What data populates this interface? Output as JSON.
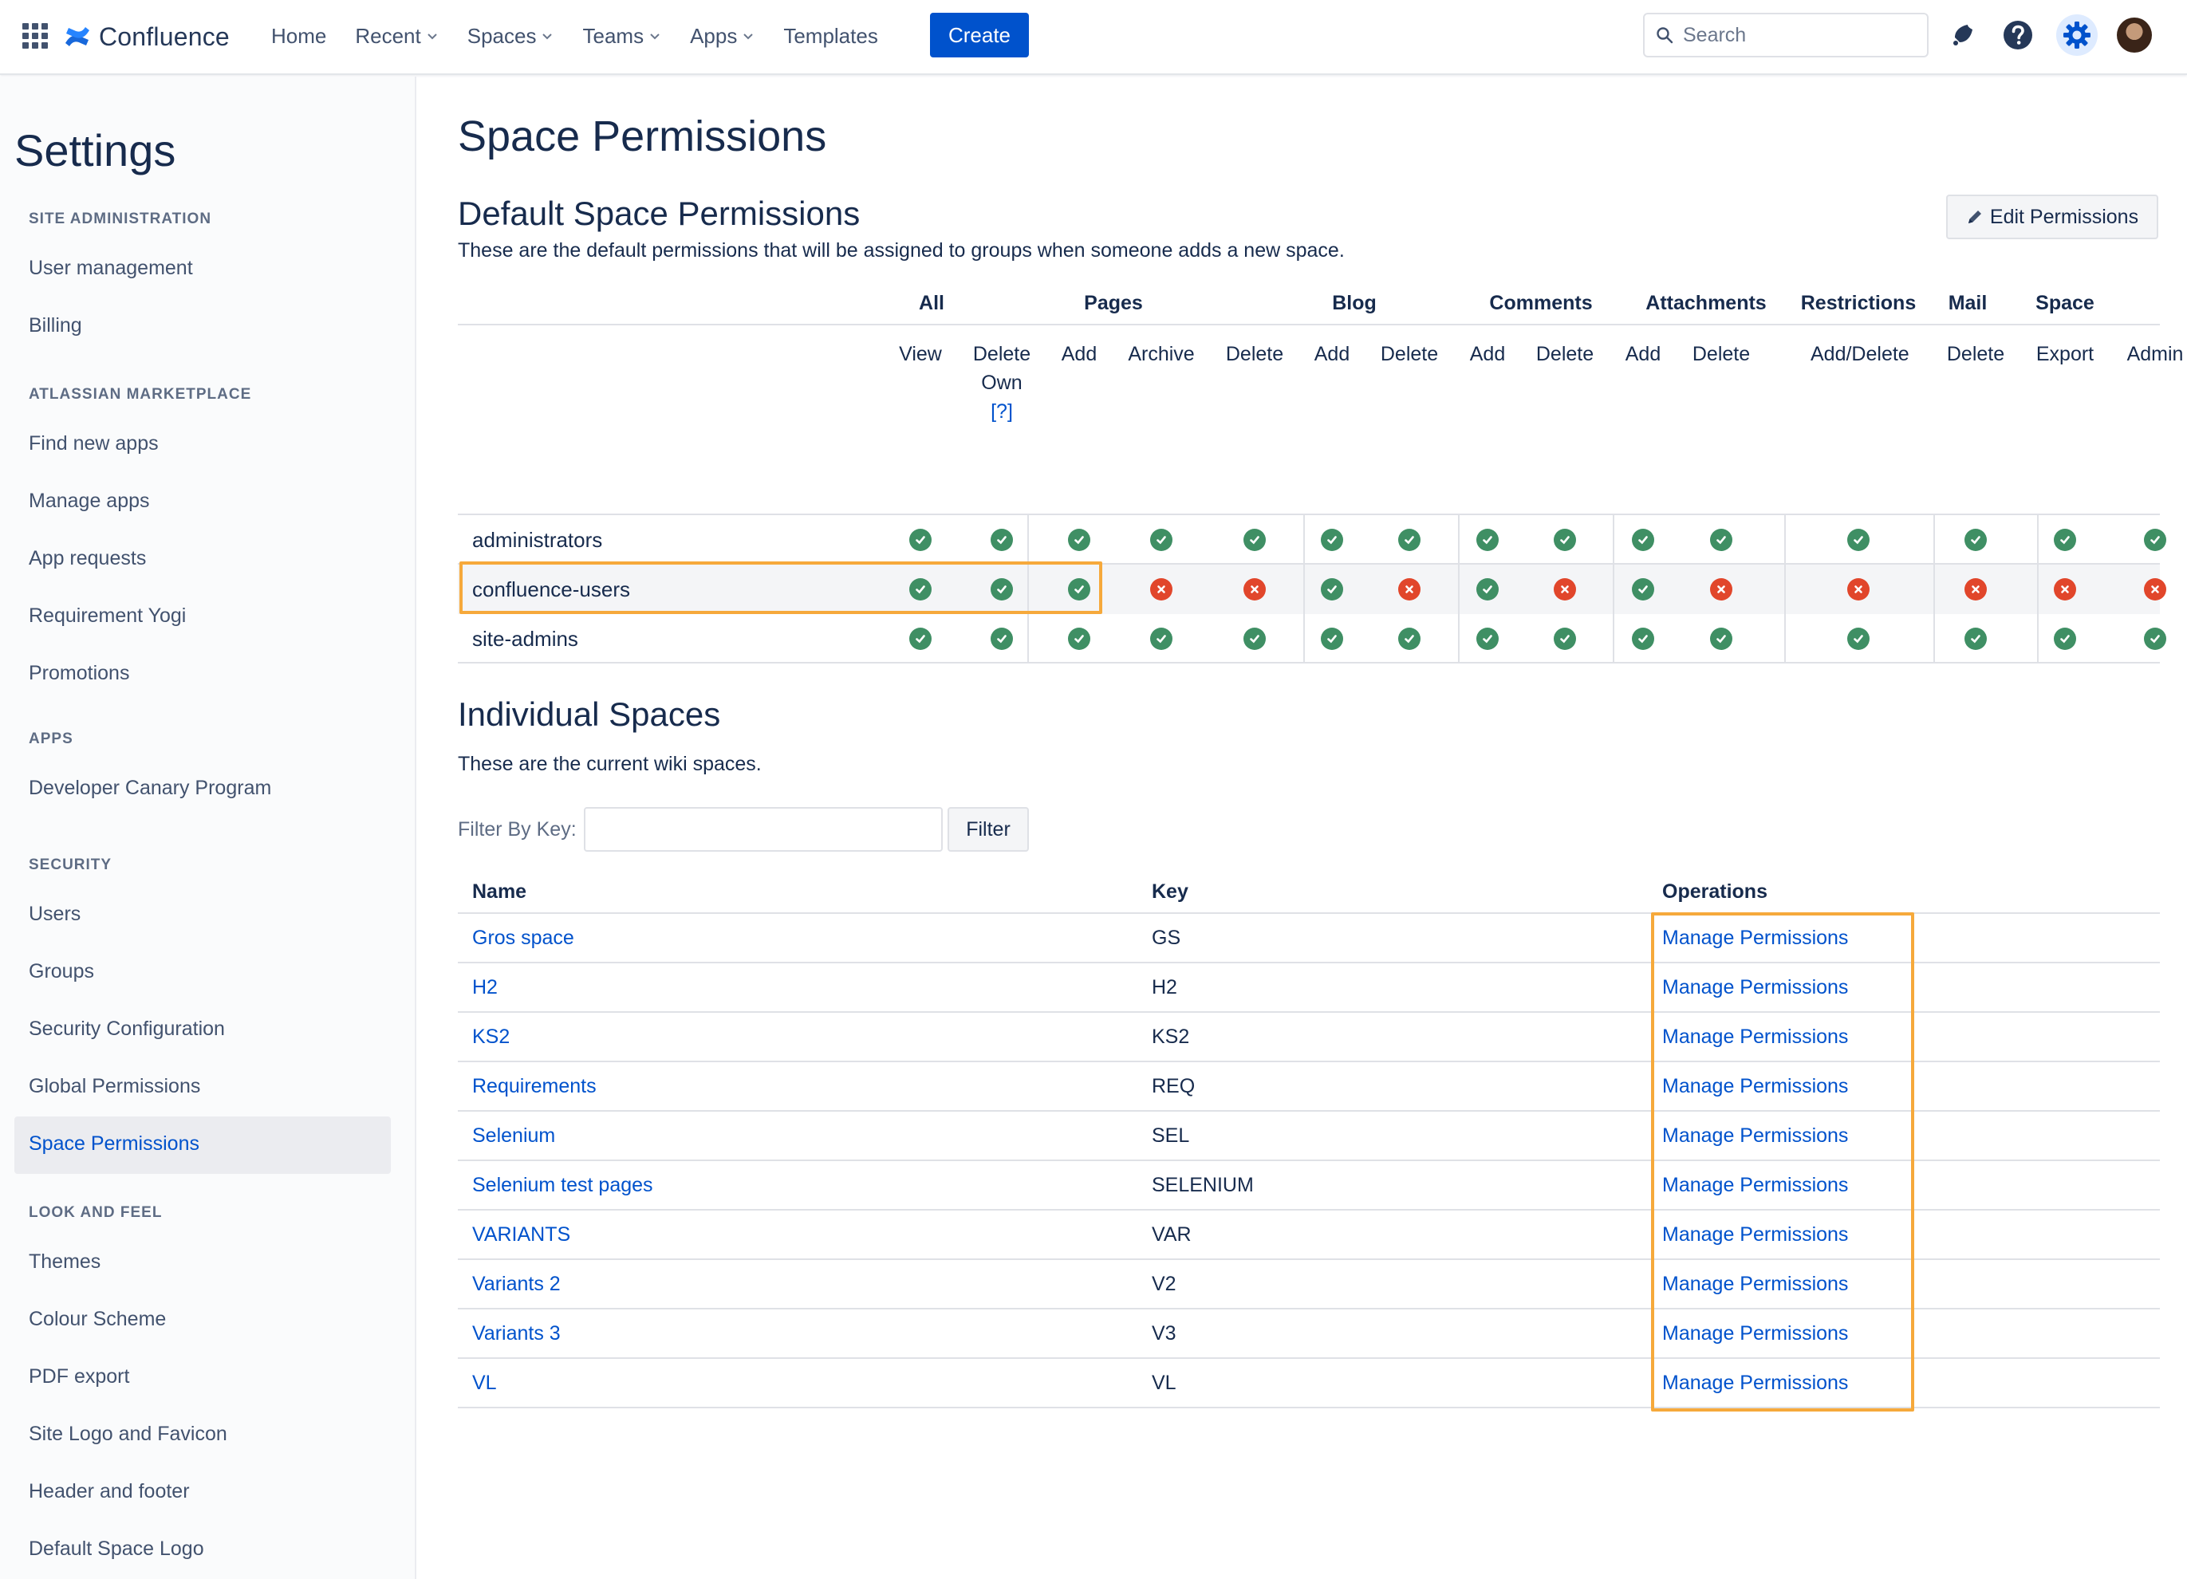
{
  "topnav": {
    "app_name": "Confluence",
    "items": [
      {
        "label": "Home",
        "dropdown": false
      },
      {
        "label": "Recent",
        "dropdown": true
      },
      {
        "label": "Spaces",
        "dropdown": true
      },
      {
        "label": "Teams",
        "dropdown": true
      },
      {
        "label": "Apps",
        "dropdown": true
      },
      {
        "label": "Templates",
        "dropdown": false
      }
    ],
    "create_label": "Create",
    "search_placeholder": "Search",
    "accent": "#0052cc"
  },
  "sidebar": {
    "title": "Settings",
    "sections": [
      {
        "heading": "SITE ADMINISTRATION",
        "items": [
          "User management",
          "Billing"
        ]
      },
      {
        "heading": "ATLASSIAN MARKETPLACE",
        "items": [
          "Find new apps",
          "Manage apps",
          "App requests",
          "Requirement Yogi",
          "Promotions"
        ]
      },
      {
        "heading": "APPS",
        "items": [
          "Developer Canary Program"
        ]
      },
      {
        "heading": "SECURITY",
        "items": [
          "Users",
          "Groups",
          "Security Configuration",
          "Global Permissions",
          "Space Permissions"
        ]
      },
      {
        "heading": "LOOK AND FEEL",
        "items": [
          "Themes",
          "Colour Scheme",
          "PDF export",
          "Site Logo and Favicon",
          "Header and footer",
          "Default Space Logo"
        ]
      }
    ],
    "active_item": "Space Permissions"
  },
  "main": {
    "title": "Space Permissions",
    "default_heading": "Default Space Permissions",
    "default_desc": "These are the default permissions that will be assigned to groups when someone adds a new space.",
    "edit_label": "Edit Permissions",
    "perm_groups": [
      "All",
      "Pages",
      "Blog",
      "Comments",
      "Attachments",
      "Restrictions",
      "Mail",
      "Space"
    ],
    "perm_columns": [
      "View",
      "Delete Own",
      "Add",
      "Archive",
      "Delete",
      "Add",
      "Delete",
      "Add",
      "Delete",
      "Add",
      "Delete",
      "Add/Delete",
      "Delete",
      "Export",
      "Admin"
    ],
    "help_link": "[?]",
    "perm_rows": [
      {
        "group": "administrators",
        "values": [
          1,
          1,
          1,
          1,
          1,
          1,
          1,
          1,
          1,
          1,
          1,
          1,
          1,
          1,
          1
        ]
      },
      {
        "group": "confluence-users",
        "values": [
          1,
          1,
          1,
          0,
          0,
          1,
          0,
          1,
          0,
          1,
          0,
          0,
          0,
          0,
          0
        ]
      },
      {
        "group": "site-admins",
        "values": [
          1,
          1,
          1,
          1,
          1,
          1,
          1,
          1,
          1,
          1,
          1,
          1,
          1,
          1,
          1
        ]
      }
    ],
    "individual_heading": "Individual Spaces",
    "individual_desc": "These are the current wiki spaces.",
    "filter_label": "Filter By Key:",
    "filter_value": "",
    "filter_button": "Filter",
    "spaces_headers": {
      "name": "Name",
      "key": "Key",
      "operations": "Operations"
    },
    "spaces": [
      {
        "name": "Gros space",
        "key": "GS",
        "op": "Manage Permissions"
      },
      {
        "name": "H2",
        "key": "H2",
        "op": "Manage Permissions"
      },
      {
        "name": "KS2",
        "key": "KS2",
        "op": "Manage Permissions"
      },
      {
        "name": "Requirements",
        "key": "REQ",
        "op": "Manage Permissions"
      },
      {
        "name": "Selenium",
        "key": "SEL",
        "op": "Manage Permissions"
      },
      {
        "name": "Selenium test pages",
        "key": "SELENIUM",
        "op": "Manage Permissions"
      },
      {
        "name": "VARIANTS",
        "key": "VAR",
        "op": "Manage Permissions"
      },
      {
        "name": "Variants 2",
        "key": "V2",
        "op": "Manage Permissions"
      },
      {
        "name": "Variants 3",
        "key": "V3",
        "op": "Manage Permissions"
      },
      {
        "name": "VL",
        "key": "VL",
        "op": "Manage Permissions"
      }
    ],
    "colors": {
      "granted": "#3f8f64",
      "denied": "#e1462b",
      "highlight": "#f6a93b",
      "link": "#0052cc"
    }
  }
}
